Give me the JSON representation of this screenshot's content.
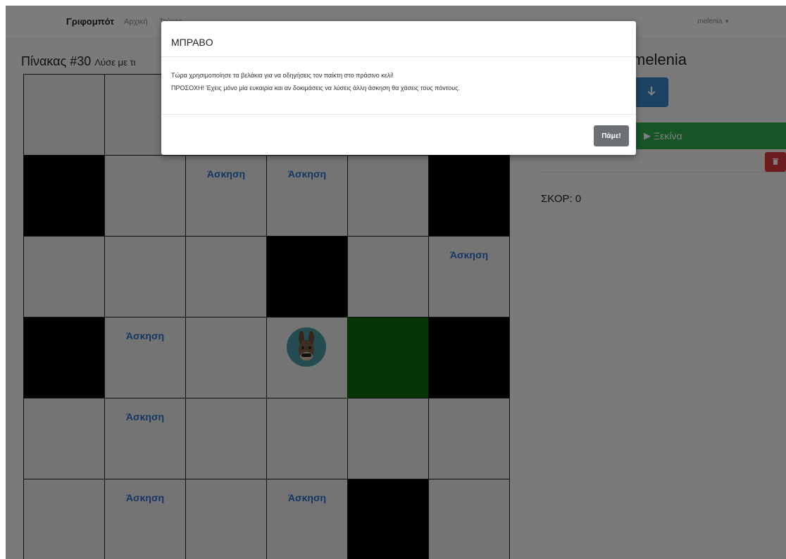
{
  "nav": {
    "brand": "Γριφομπότ",
    "links": [
      "Αρχική",
      "Τεύχος"
    ],
    "user": "melenia"
  },
  "board": {
    "title": "Πίνακας #30",
    "subtitle": "Λύσε με τι",
    "exercise_label": "Άσκηση",
    "cells": [
      [
        {
          "type": "empty"
        },
        {
          "type": "empty"
        },
        {
          "type": "empty"
        },
        {
          "type": "empty"
        },
        {
          "type": "empty"
        },
        {
          "type": "empty"
        }
      ],
      [
        {
          "type": "blocked"
        },
        {
          "type": "empty"
        },
        {
          "type": "exercise"
        },
        {
          "type": "exercise"
        },
        {
          "type": "empty"
        },
        {
          "type": "blocked"
        }
      ],
      [
        {
          "type": "empty"
        },
        {
          "type": "empty"
        },
        {
          "type": "empty"
        },
        {
          "type": "blocked"
        },
        {
          "type": "empty"
        },
        {
          "type": "exercise"
        }
      ],
      [
        {
          "type": "blocked"
        },
        {
          "type": "exercise"
        },
        {
          "type": "empty"
        },
        {
          "type": "player"
        },
        {
          "type": "goal"
        },
        {
          "type": "blocked"
        }
      ],
      [
        {
          "type": "empty"
        },
        {
          "type": "exercise"
        },
        {
          "type": "empty"
        },
        {
          "type": "empty"
        },
        {
          "type": "empty"
        },
        {
          "type": "empty"
        }
      ],
      [
        {
          "type": "empty"
        },
        {
          "type": "exercise"
        },
        {
          "type": "empty"
        },
        {
          "type": "exercise"
        },
        {
          "type": "blocked"
        },
        {
          "type": "empty"
        }
      ]
    ]
  },
  "side": {
    "username": "melenia",
    "arrow_icon": "arrow-down-icon",
    "start_label": "Ξεκίνα",
    "score_label": "ΣΚΟΡ: 0"
  },
  "modal": {
    "title": "ΜΠΡΑΒΟ",
    "body_line1": "Τώρα χρησιμοποίησε τα βελάκια για να οδηγήσεις τον παίκτη στο πράσινο κελί!",
    "body_line2": "ΠΡΟΣΟΧΗ! Έχεις μόνο μία ευκαιρία και αν δοκιμάσεις να λύσεις άλλη άσκηση θα χάσεις τους πόντους.",
    "ok_label": "Πάμε!"
  },
  "colors": {
    "goal": "#0b6b0b",
    "blocked": "#000000",
    "start": "#2eaa4f",
    "arrow_button": "#3a86c8",
    "delete": "#d9383a"
  }
}
